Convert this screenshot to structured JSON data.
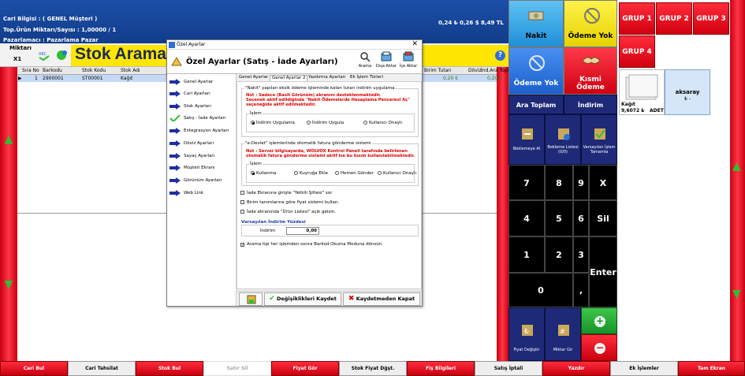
{
  "topbar": {
    "cari": "Cari Bilgisi  : ( GENEL Müşteri )",
    "toplam": "Top.Ürün Miktarı/Sayısı : 1,00000  /  1",
    "pazarlamaci": "Pazarlamacı : Pazarlama Pazar",
    "totals": "0,24 ₺  0,26 $  8,49 TL"
  },
  "search": {
    "qty_label": "Miktarı",
    "qty_value": "X1",
    "stock_label": "Stok Arama",
    "help": "?"
  },
  "grid": {
    "columns": [
      "Sıra No",
      "Barkodu",
      "Stok Kodu",
      "Stok Adı",
      "Birim Tutarı",
      "Döviz",
      "İnd.Ara Topl..."
    ],
    "row": {
      "no": "1",
      "barkod": "2900001",
      "kod": "ST00001",
      "ad": "Kağıt",
      "tutar": "0,20 €",
      "doviz": "",
      "ara": "0,20 €"
    }
  },
  "right_panel": {
    "nakit": "Nakit",
    "odeme_yok_1": "Ödeme Yok",
    "odeme_yok_2": "Ödeme Yok",
    "kismi": "Kısmi\nÖdeme",
    "grup": [
      "GRUP 1",
      "GRUP 2",
      "GRUP 3",
      "GRUP 4"
    ],
    "kagit_name": "Kağıt",
    "kagit_price": "9,6072 ₺",
    "kagit_unit": "ADET",
    "aksaray": "aksaray",
    "aksaray_sub": "₺  -",
    "ara_toplam": "Ara Toplam",
    "indirim": "İndirim",
    "bekleme_al": "Beklemeye Al",
    "bekleme_listesi": "Bekleme Listesi\n(0/0)",
    "varsayilan": "Varsayılan İşlem\nTamamla",
    "keys": [
      "7",
      "8",
      "9",
      "X",
      "4",
      "5",
      "6",
      "Sil",
      "1",
      "2",
      "3",
      "Enter",
      "0",
      ","
    ],
    "fiyat_degistir": "Fiyat Değiştir",
    "miktar_gir": "Miktar Gir"
  },
  "bottom": [
    "Cari Bul",
    "Cari Tahsilat",
    "Stok Bul",
    "Satır Sil",
    "Fiyat Gör",
    "Stok Fiyat Dğşt.",
    "Fiş Bilgileri",
    "Satış İptali",
    "Yazdır",
    "Ek İşlemler",
    "Tam Ekran"
  ],
  "dialog": {
    "window_title": "Özel Ayarlar",
    "header": "Özel Ayarlar (Satış - İade Ayarları)",
    "tools": [
      "Arama",
      "Dışa Aktar",
      "İçe Aktar"
    ],
    "nav": [
      "Genel Ayarlar",
      "Cari Ayarları",
      "Stok Ayarları",
      "Satış - İade Ayarları",
      "Entegrasyon Ayarları",
      "Döviz Ayarları",
      "Sayaç Ayarları",
      "Müşteri Ekranı",
      "Görünüm Ayarları",
      "Web Link"
    ],
    "tabs": [
      "Genel Ayarlar",
      "Genel Ayarlar 2",
      "Yazdırma Ayarları",
      "Ek İşlem Türleri"
    ],
    "group1_title": "\"Nakit\" yapılan eksik ödeme işleminde kalan tutarı indirim uygulama",
    "group1_note": [
      "Not : Sadece (Basit Görünüm) ekranını desteklenmektedir.",
      "Seçenek aktif edildiğinde \"Nakit Ödemelerde Hesaplama Penceresi Aç\"",
      "seçeneğide aktif edilmektedir."
    ],
    "islem1": "İşlem",
    "radios1": [
      "İndirim Uygulama",
      "İndirim Uygula",
      "Kullanıcı Onaylı"
    ],
    "group2_title": "\"e-Devlet\" işlemlerinde otomatik fatura gönderme sistemi",
    "group2_note": [
      "Not : Server bilgisayarda, WOLVOX Kontrol Paneli tarafında belirlenen",
      "otomatik fatura gönderme sistemi aktif ise bu kısım kullanılabilmektedir."
    ],
    "islem2": "İşlem",
    "radios2": [
      "Kullanma",
      "Kuyruğa Ekle",
      "Hemen Gönder",
      "Kullanıcı Onaylı"
    ],
    "checks": [
      "İade Ekranına girişte \"Yetkili Şifresi\" sor",
      "Birim tanımlarına göre fiyat sistemi kullan.",
      "İade ekranında \"Ürün Listesi\" açık gelsin."
    ],
    "varsayilan_title": "Varsayılan İndirim Yüzdesi",
    "indirim_label": "İndirim",
    "indirim_value": "0,00",
    "check_last": "Arama tipi her işlemden sonra Barkod Okuma Moduna dönsün.",
    "save": "Değişiklikleri Kaydet",
    "close": "Kaydetmeden Kapat"
  },
  "colors": {
    "accent_blue": "#1c4fa8",
    "red": "#e0101f",
    "yellow": "#ffe600"
  }
}
